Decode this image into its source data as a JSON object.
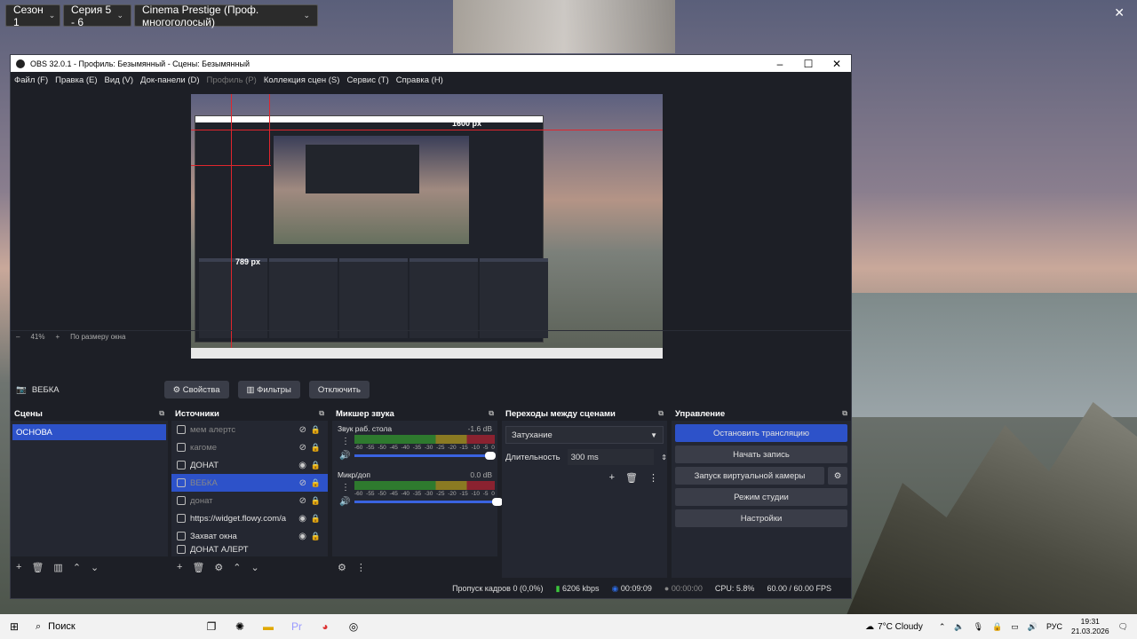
{
  "overlay": {
    "season": "Сезон 1",
    "series": "Серия 5 - 6",
    "voice": "Cinema Prestige (Проф. многоголосый)"
  },
  "window": {
    "title": "OBS 32.0.1 - Профиль: Безымянный - Сцены: Безымянный"
  },
  "menu": [
    "Файл (F)",
    "Правка (E)",
    "Вид (V)",
    "Док-панели (D)",
    "Профиль (P)",
    "Коллекция сцен (S)",
    "Сервис (T)",
    "Справка (H)"
  ],
  "preview": {
    "label_width": "1600 px",
    "label_height": "789 px",
    "zoom": "41%",
    "fit": "По размеру окна"
  },
  "source_bar": {
    "name": "ВЕБКА",
    "properties": "Свойства",
    "filters": "Фильтры",
    "disable": "Отключить"
  },
  "scenes": {
    "title": "Сцены",
    "items": [
      "ОСНОВА"
    ]
  },
  "sources": {
    "title": "Источники",
    "items": [
      {
        "label": "мем алертс",
        "visible": false
      },
      {
        "label": "кагоме",
        "visible": false
      },
      {
        "label": "ДОНАТ",
        "visible": true
      },
      {
        "label": "ВЕБКА",
        "visible": false
      },
      {
        "label": "донат",
        "visible": false
      },
      {
        "label": "https://widget.flowy.com/a",
        "visible": true
      },
      {
        "label": "Захват окна",
        "visible": true
      },
      {
        "label": "ДОНАТ АЛЕРТ",
        "visible": true
      }
    ]
  },
  "mixer": {
    "title": "Микшер звука",
    "channels": [
      {
        "name": "Звук раб. стола",
        "db": "-1.6 dB",
        "level": 0.95
      },
      {
        "name": "Микр/доп",
        "db": "0.0 dB",
        "level": 1.0
      }
    ],
    "scale": [
      "-60",
      "-55",
      "-50",
      "-45",
      "-40",
      "-35",
      "-30",
      "-25",
      "-20",
      "-15",
      "-10",
      "-5",
      "0"
    ]
  },
  "transitions": {
    "title": "Переходы между сценами",
    "selected": "Затухание",
    "duration_label": "Длительность",
    "duration_value": "300 ms"
  },
  "controls": {
    "title": "Управление",
    "buttons": [
      "Остановить трансляцию",
      "Начать запись",
      "Запуск виртуальной камеры",
      "Режим студии",
      "Настройки"
    ]
  },
  "status": {
    "dropped": "Пропуск кадров 0 (0,0%)",
    "bitrate": "6206 kbps",
    "stream_time": "00:09:09",
    "rec_time": "00:00:00",
    "cpu": "CPU: 5.8%",
    "fps": "60.00 / 60.00 FPS"
  },
  "taskbar": {
    "search": "Поиск",
    "weather": "7°C  Cloudy",
    "lang": "РУС",
    "time": "19:31",
    "date": "21.03.2026"
  }
}
